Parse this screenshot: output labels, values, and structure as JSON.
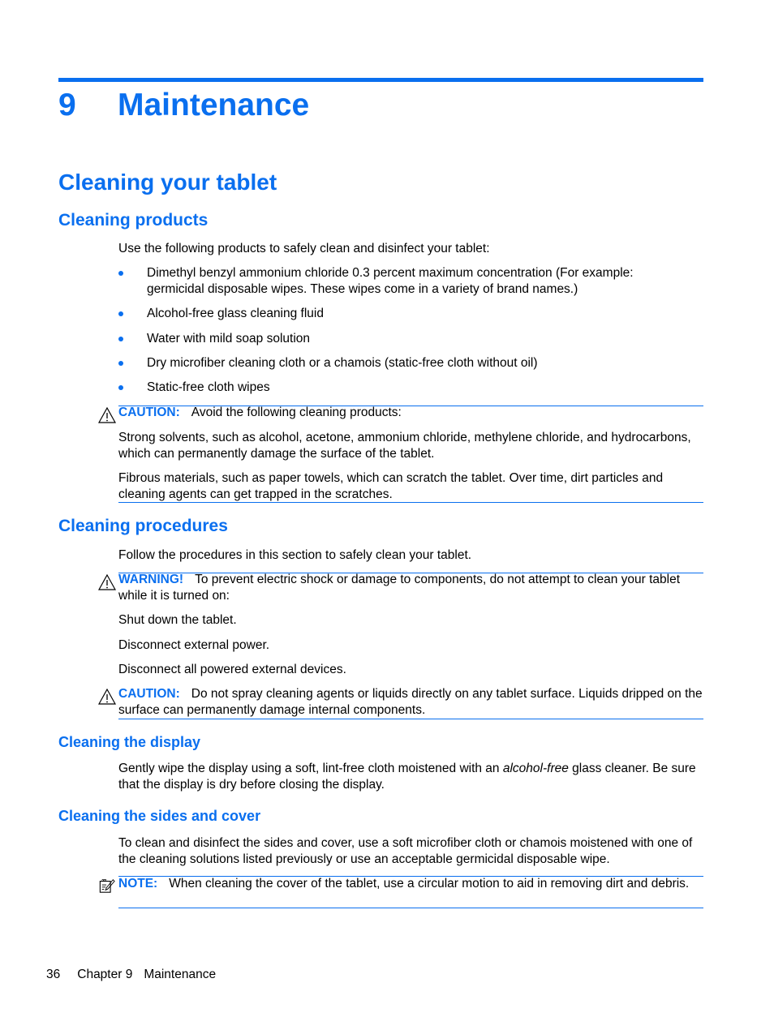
{
  "chapter": {
    "number": "9",
    "title": "Maintenance"
  },
  "section": {
    "title": "Cleaning your tablet"
  },
  "products": {
    "heading": "Cleaning products",
    "intro": "Use the following products to safely clean and disinfect your tablet:",
    "items": [
      "Dimethyl benzyl ammonium chloride 0.3 percent maximum concentration (For example: germicidal disposable wipes. These wipes come in a variety of brand names.)",
      "Alcohol-free glass cleaning fluid",
      "Water with mild soap solution",
      "Dry microfiber cleaning cloth or a chamois (static-free cloth without oil)",
      "Static-free cloth wipes"
    ],
    "caution": {
      "label": "CAUTION:",
      "text": "Avoid the following cleaning products:",
      "paragraphs": [
        "Strong solvents, such as alcohol, acetone, ammonium chloride, methylene chloride, and hydrocarbons, which can permanently damage the surface of the tablet.",
        "Fibrous materials, such as paper towels, which can scratch the tablet. Over time, dirt particles and cleaning agents can get trapped in the scratches."
      ]
    }
  },
  "procedures": {
    "heading": "Cleaning procedures",
    "intro": "Follow the procedures in this section to safely clean your tablet.",
    "warning": {
      "label": "WARNING!",
      "text": "To prevent electric shock or damage to components, do not attempt to clean your tablet while it is turned on:",
      "steps": [
        "Shut down the tablet.",
        "Disconnect external power.",
        "Disconnect all powered external devices."
      ]
    },
    "caution": {
      "label": "CAUTION:",
      "text": "Do not spray cleaning agents or liquids directly on any tablet surface. Liquids dripped on the surface can permanently damage internal components."
    }
  },
  "display": {
    "heading": "Cleaning the display",
    "text_before": "Gently wipe the display using a soft, lint-free cloth moistened with an ",
    "text_italic": "alcohol-free",
    "text_after": " glass cleaner. Be sure that the display is dry before closing the display."
  },
  "sides": {
    "heading": "Cleaning the sides and cover",
    "text": "To clean and disinfect the sides and cover, use a soft microfiber cloth or chamois moistened with one of the cleaning solutions listed previously or use an acceptable germicidal disposable wipe.",
    "note": {
      "label": "NOTE:",
      "text": "When cleaning the cover of the tablet, use a circular motion to aid in removing dirt and debris."
    }
  },
  "footer": {
    "page": "36",
    "chapter": "Chapter 9",
    "title": "Maintenance"
  }
}
